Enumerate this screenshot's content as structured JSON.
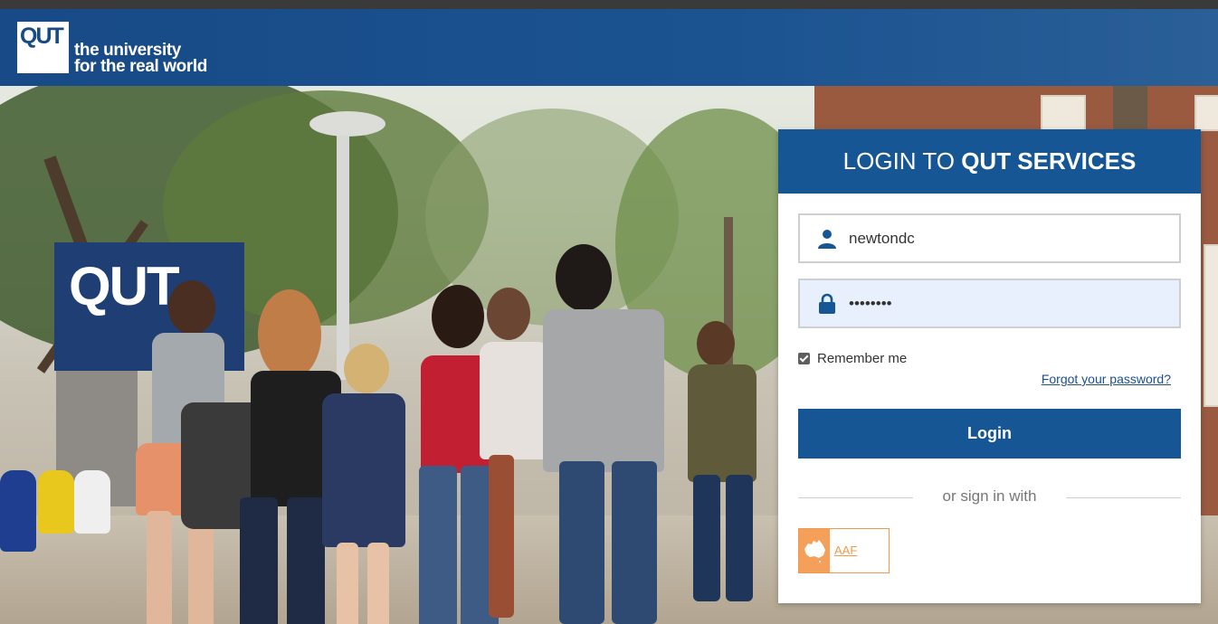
{
  "header": {
    "logo_text": "QUT",
    "tagline_line1": "the university",
    "tagline_line2": "for the real world"
  },
  "background": {
    "sign_text": "QUT"
  },
  "login": {
    "title_prefix": "LOGIN TO ",
    "title_bold": "QUT SERVICES",
    "username_value": "newtondc",
    "password_value": "••••••••",
    "remember_label": "Remember me",
    "remember_checked": true,
    "forgot_label": "Forgot your password?",
    "login_button": "Login",
    "divider_text": "or sign in with",
    "aaf_label": "AAF"
  },
  "colors": {
    "brand_blue": "#175694",
    "aaf_orange": "#f29a4a"
  },
  "icons": {
    "username": "user-icon",
    "password": "lock-icon",
    "aaf": "australia-map-icon"
  }
}
